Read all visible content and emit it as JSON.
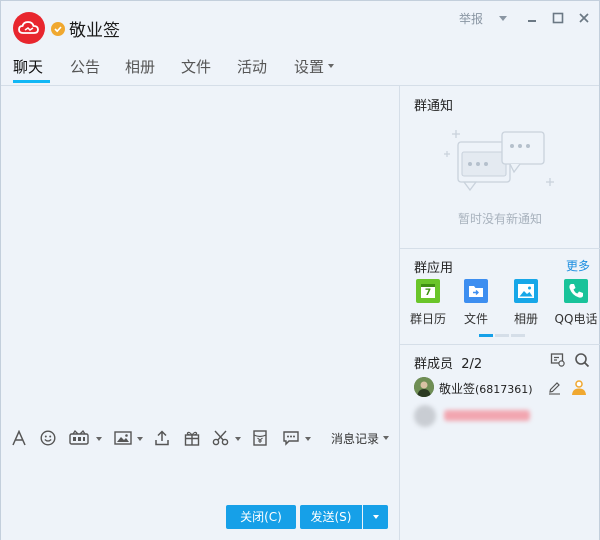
{
  "header": {
    "group_name": "敬业签",
    "report_label": "举报"
  },
  "tabs": [
    {
      "label": "聊天"
    },
    {
      "label": "公告"
    },
    {
      "label": "相册"
    },
    {
      "label": "文件"
    },
    {
      "label": "活动"
    },
    {
      "label": "设置"
    }
  ],
  "toolbar": {
    "history_label": "消息记录"
  },
  "buttons": {
    "close_label": "关闭(C)",
    "send_label": "发送(S)"
  },
  "notice": {
    "title": "群通知",
    "empty_text": "暂时没有新通知"
  },
  "apps": {
    "title": "群应用",
    "more_label": "更多",
    "items": [
      {
        "label": "群日历",
        "icon": "calendar-icon",
        "color": "#6ac52a"
      },
      {
        "label": "文件",
        "icon": "folder-icon",
        "color": "#3d8ef0"
      },
      {
        "label": "相册",
        "icon": "photo-icon",
        "color": "#17a7e8"
      },
      {
        "label": "QQ电话",
        "icon": "phone-icon",
        "color": "#19c39a"
      }
    ],
    "calendar_day": "7"
  },
  "members": {
    "title": "群成员",
    "count": "2/2",
    "items": [
      {
        "name": "敬业签",
        "id": "(6817361)"
      }
    ]
  },
  "colors": {
    "accent": "#12b7f5",
    "button": "#16a0e8",
    "avatar": "#e8262e",
    "badge": "#f0a830"
  }
}
